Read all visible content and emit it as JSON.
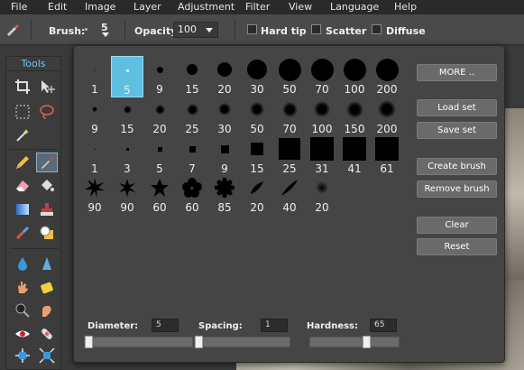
{
  "menu": [
    "File",
    "Edit",
    "Image",
    "Layer",
    "Adjustment",
    "Filter",
    "View",
    "Language",
    "Help"
  ],
  "toolbar": {
    "brush_label": "Brush:",
    "brush_size": "5",
    "opacity_label": "Opacity:",
    "opacity_value": "100",
    "hard_tip_label": "Hard tip",
    "scatter_label": "Scatter",
    "diffuse_label": "Diffuse"
  },
  "tools_panel": {
    "title": "Tools"
  },
  "brushes": [
    {
      "size": "1"
    },
    {
      "size": "5"
    },
    {
      "size": "9"
    },
    {
      "size": "15"
    },
    {
      "size": "20"
    },
    {
      "size": "30"
    },
    {
      "size": "50"
    },
    {
      "size": "70"
    },
    {
      "size": "100"
    },
    {
      "size": "200"
    },
    {
      "size": "9"
    },
    {
      "size": "15"
    },
    {
      "size": "20"
    },
    {
      "size": "25"
    },
    {
      "size": "30"
    },
    {
      "size": "50"
    },
    {
      "size": "70"
    },
    {
      "size": "100"
    },
    {
      "size": "150"
    },
    {
      "size": "200"
    },
    {
      "size": "1"
    },
    {
      "size": "3"
    },
    {
      "size": "5"
    },
    {
      "size": "7"
    },
    {
      "size": "9"
    },
    {
      "size": "15"
    },
    {
      "size": "25"
    },
    {
      "size": "31"
    },
    {
      "size": "41"
    },
    {
      "size": "61"
    },
    {
      "size": "90"
    },
    {
      "size": "90"
    },
    {
      "size": "60"
    },
    {
      "size": "60"
    },
    {
      "size": "85"
    },
    {
      "size": "20"
    },
    {
      "size": "40"
    },
    {
      "size": "20"
    }
  ],
  "buttons": {
    "more": "MORE ..",
    "load_set": "Load set",
    "save_set": "Save set",
    "create_brush": "Create brush",
    "remove_brush": "Remove brush",
    "clear": "Clear",
    "reset": "Reset"
  },
  "sliders": {
    "diameter_label": "Diameter:",
    "diameter_value": "5",
    "spacing_label": "Spacing:",
    "spacing_value": "1",
    "hardness_label": "Hardness:",
    "hardness_value": "65"
  },
  "colors": {
    "accent": "#5fbfe0",
    "panel": "#454545",
    "menubar": "#2a2a2a"
  }
}
